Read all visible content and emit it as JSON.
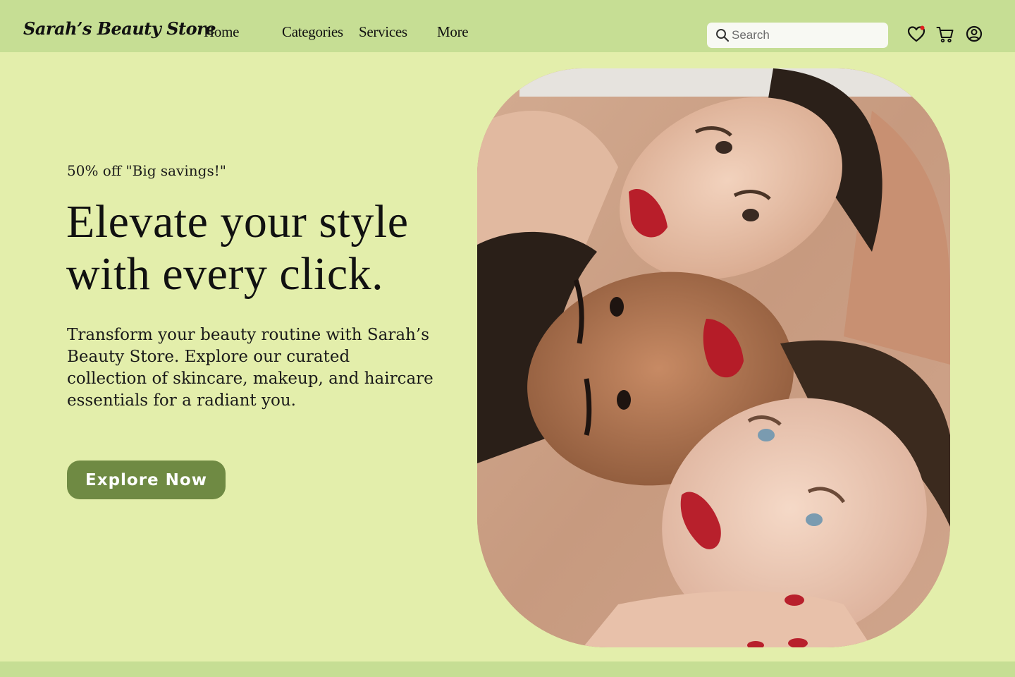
{
  "brand": {
    "name": "Sarah’s Beauty Store"
  },
  "nav": {
    "items": [
      {
        "label": "Home"
      },
      {
        "label": "Categories"
      },
      {
        "label": "Services"
      },
      {
        "label": "More"
      }
    ]
  },
  "search": {
    "placeholder": "Search",
    "value": ""
  },
  "header_icons": [
    "heart-icon",
    "cart-icon",
    "user-account-icon"
  ],
  "hero": {
    "promo": "50% off \"Big savings!\"",
    "headline": "Elevate your style with every click.",
    "description": "Transform your beauty routine with Sarah’s Beauty Store. Explore our curated collection of skincare, makeup, and haircare essentials for a radiant you.",
    "cta_label": "Explore Now"
  },
  "colors": {
    "header_bg": "#c6de94",
    "page_bg": "#e3eeab",
    "button_bg": "#6f8a43",
    "notification_dot": "#e02020"
  }
}
